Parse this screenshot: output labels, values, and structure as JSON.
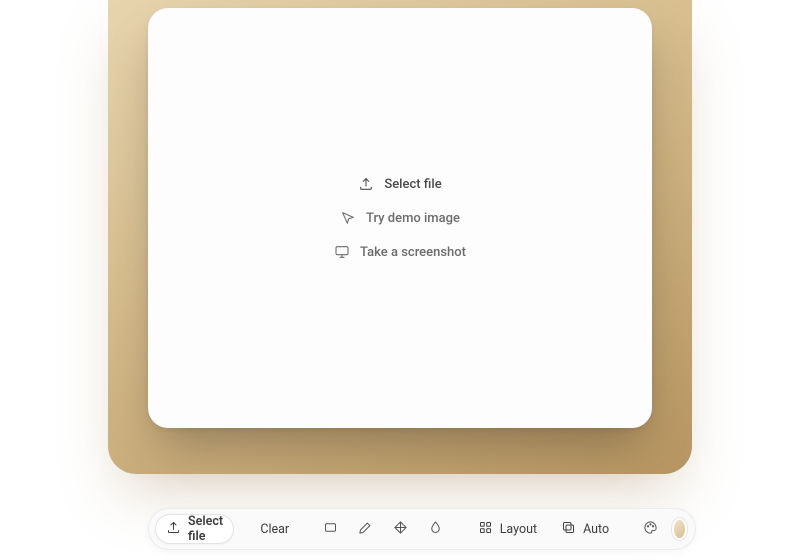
{
  "dropzone": {
    "select_file": "Select file",
    "try_demo": "Try demo image",
    "screenshot": "Take a screenshot"
  },
  "toolbar": {
    "select_file": "Select file",
    "clear": "Clear",
    "layout": "Layout",
    "auto": "Auto"
  },
  "colors": {
    "backdrop_swatch": "#d8be92"
  }
}
